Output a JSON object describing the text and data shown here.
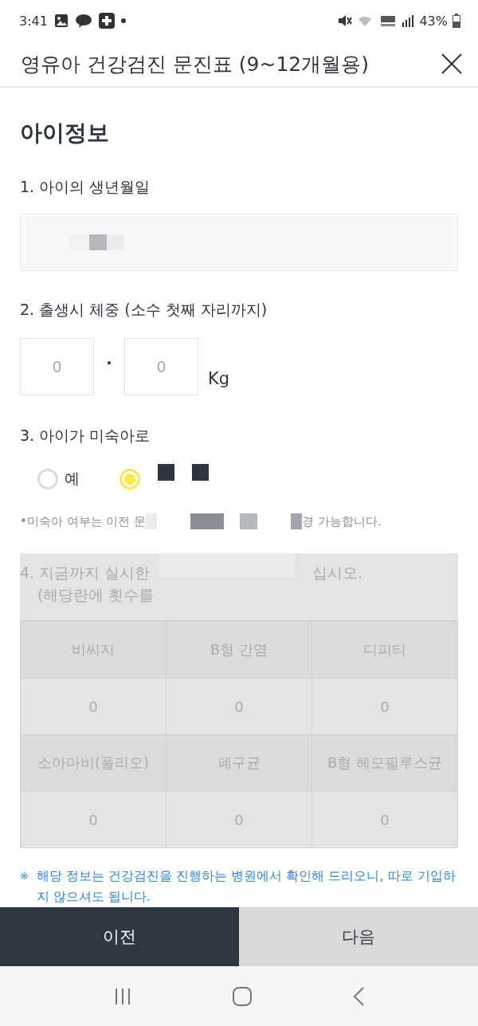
{
  "status_bar": {
    "time": "3:41",
    "battery": "43%"
  },
  "header": {
    "title": "영유아 건강검진 문진표 (9~12개월용)"
  },
  "section_title": "아이정보",
  "q1": {
    "label": "1. 아이의 생년월일"
  },
  "q2": {
    "label": "2. 출생시 체중 (소수 첫째 자리까지)",
    "integer_placeholder": "0",
    "dot": "·",
    "decimal_placeholder": "0",
    "unit": "Kg"
  },
  "q3": {
    "label": "3. 아이가 미숙아로",
    "options": [
      {
        "label": "예",
        "selected": false
      },
      {
        "selected": true
      }
    ],
    "note_start": "•미숙아 여부는 이전 문",
    "note_end": "경 가능합니다."
  },
  "q4": {
    "disabled": true,
    "label_start": "4. 지금까지 실시한",
    "label_end": "십시오.",
    "sublabel": "(해당란에 횟수를",
    "rows": [
      {
        "kind": "header",
        "cells": [
          "비씨지",
          "B형 간염",
          "디피티"
        ]
      },
      {
        "kind": "value",
        "cells": [
          "0",
          "0",
          "0"
        ]
      },
      {
        "kind": "header",
        "cells": [
          "소아마비(폴리오)",
          "폐구균",
          "B형 헤모필루스균"
        ]
      },
      {
        "kind": "value",
        "cells": [
          "0",
          "0",
          "0"
        ]
      }
    ]
  },
  "footnote": {
    "mark": "※",
    "text": "해당 정보는 건강검진을 진행하는 병원에서 확인해 드리오니, 따로 기입하지 않으셔도 됩니다."
  },
  "buttons": [
    {
      "label": "이전",
      "kind": "primary"
    },
    {
      "label": "다음",
      "kind": "secondary"
    }
  ]
}
